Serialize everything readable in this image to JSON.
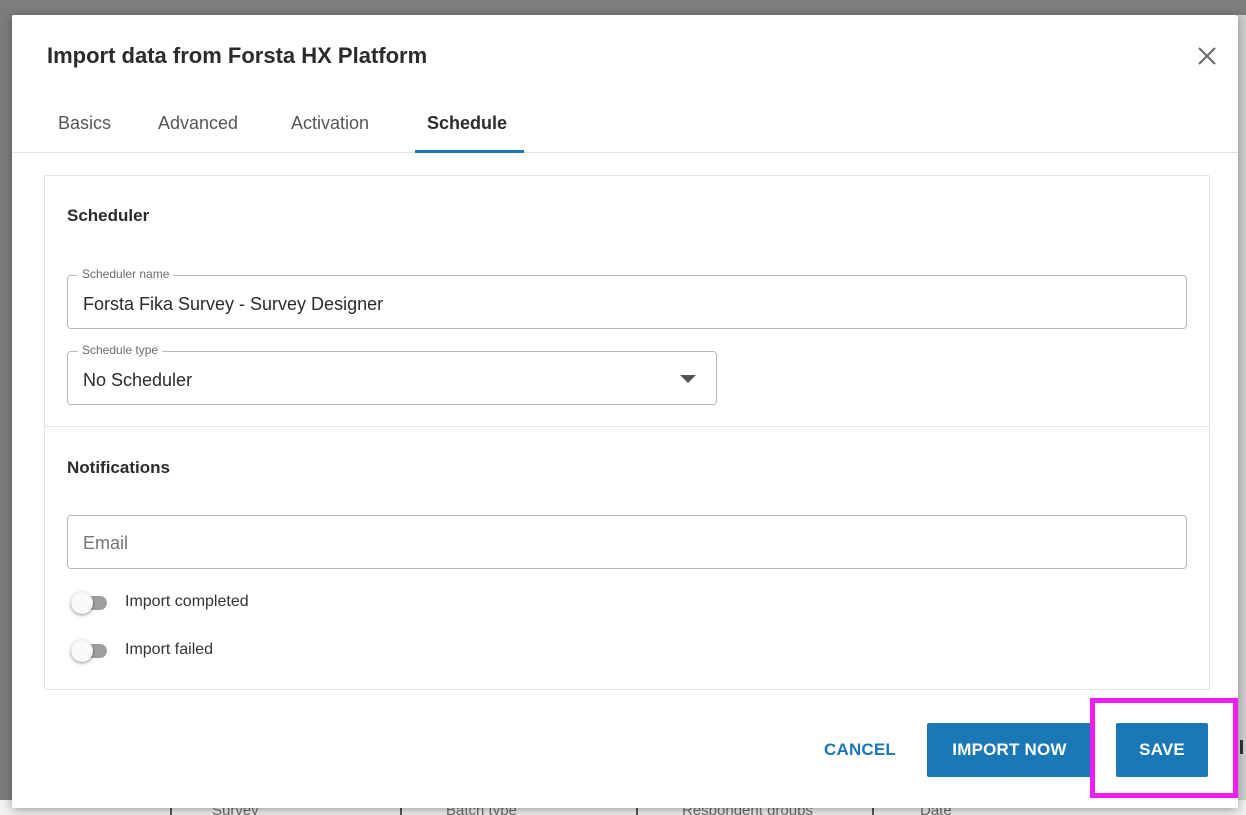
{
  "background": {
    "table_columns": [
      "Survey",
      "Batch type",
      "Respondent groups",
      "Date"
    ]
  },
  "dialog": {
    "title": "Import data from Forsta HX Platform",
    "close_icon": "close-icon",
    "tabs": [
      {
        "label": "Basics",
        "active": false
      },
      {
        "label": "Advanced",
        "active": false
      },
      {
        "label": "Activation",
        "active": false
      },
      {
        "label": "Schedule",
        "active": true
      }
    ],
    "scheduler": {
      "title": "Scheduler",
      "name_field": {
        "label": "Scheduler name",
        "value": "Forsta Fika Survey - Survey Designer"
      },
      "type_field": {
        "label": "Schedule type",
        "value": "No Scheduler",
        "icon": "chevron-down-icon"
      }
    },
    "notifications": {
      "title": "Notifications",
      "email": {
        "placeholder": "Email",
        "value": ""
      },
      "toggles": [
        {
          "label": "Import completed",
          "on": false
        },
        {
          "label": "Import failed",
          "on": false
        }
      ]
    },
    "actions": {
      "cancel": "CANCEL",
      "import_now": "IMPORT NOW",
      "save": "SAVE"
    }
  },
  "colors": {
    "accent": "#1b78b6",
    "highlight": "#f01df0",
    "toggle_off": "#9e9e9e"
  }
}
